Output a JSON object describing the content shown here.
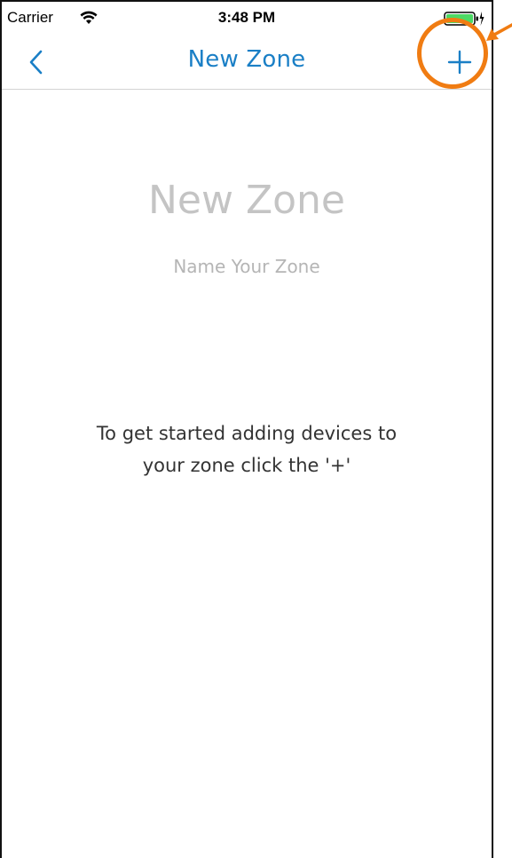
{
  "status_bar": {
    "carrier": "Carrier",
    "time": "3:48 PM"
  },
  "nav": {
    "title": "New Zone",
    "back_icon": "chevron-left-icon",
    "add_icon": "plus-icon"
  },
  "main": {
    "zone_title": "New Zone",
    "zone_name_placeholder": "Name Your Zone",
    "instructions": "To get started adding devices to your zone click the '+'"
  },
  "colors": {
    "accent": "#1a7fc6",
    "highlight": "#f07c12",
    "battery": "#4cd964"
  }
}
